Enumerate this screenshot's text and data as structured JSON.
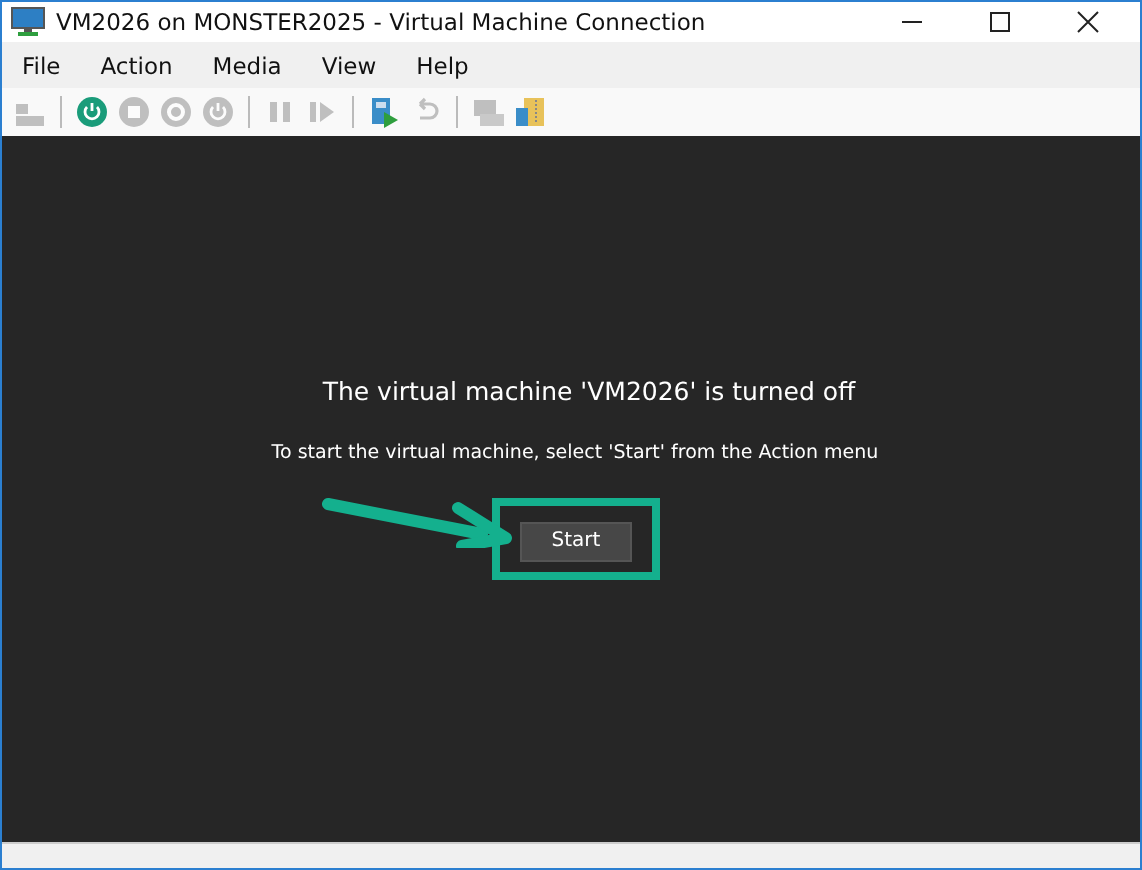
{
  "window": {
    "title": "VM2026 on MONSTER2025 - Virtual Machine Connection"
  },
  "menu": [
    "File",
    "Action",
    "Media",
    "View",
    "Help"
  ],
  "toolbar": [
    {
      "kind": "ctrlaltdel",
      "disabled": true
    },
    {
      "kind": "separator"
    },
    {
      "kind": "start",
      "disabled": false
    },
    {
      "kind": "turnoff",
      "disabled": true
    },
    {
      "kind": "shutdown",
      "disabled": true
    },
    {
      "kind": "save",
      "disabled": true
    },
    {
      "kind": "separator"
    },
    {
      "kind": "pause",
      "disabled": true
    },
    {
      "kind": "resume",
      "disabled": true
    },
    {
      "kind": "separator"
    },
    {
      "kind": "checkpoint",
      "disabled": false
    },
    {
      "kind": "revert",
      "disabled": true
    },
    {
      "kind": "separator"
    },
    {
      "kind": "enhanced",
      "disabled": true
    },
    {
      "kind": "share",
      "disabled": false
    }
  ],
  "screen": {
    "heading": "The virtual machine 'VM2026' is turned off",
    "message": "To start the virtual machine, select 'Start' from the Action menu",
    "button": "Start"
  }
}
